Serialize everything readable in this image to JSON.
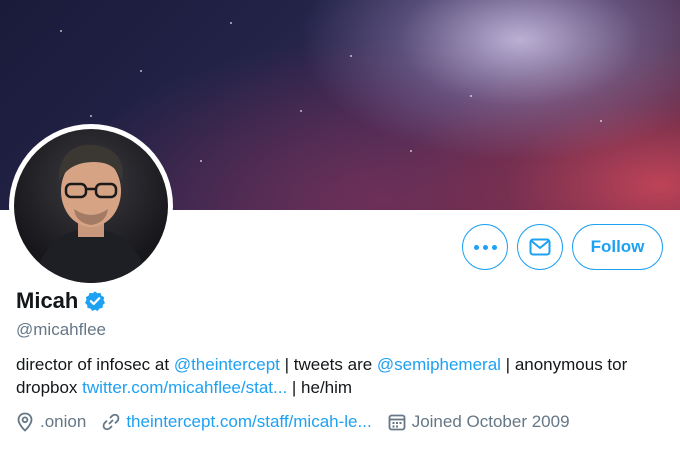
{
  "profile": {
    "name": "Micah",
    "handle": "@micahflee",
    "bio": {
      "part1": "director of infosec at ",
      "mention1": "@theintercept",
      "part2": " | tweets are ",
      "mention2": "@semiphemeral",
      "part3": " | anonymous tor dropbox ",
      "link": "twitter.com/micahflee/stat...",
      "part4": " | he/him"
    },
    "location": ".onion",
    "website": "theintercept.com/staff/micah-le...",
    "joined": "Joined October 2009"
  },
  "actions": {
    "follow_label": "Follow"
  },
  "icons": {
    "more": "more-dots-icon",
    "message": "envelope-icon",
    "verified": "verified-badge-icon",
    "location": "location-pin-icon",
    "link": "link-icon",
    "calendar": "calendar-icon"
  },
  "colors": {
    "accent": "#1da1f2",
    "secondary_text": "#657786",
    "primary_text": "#14171a"
  }
}
